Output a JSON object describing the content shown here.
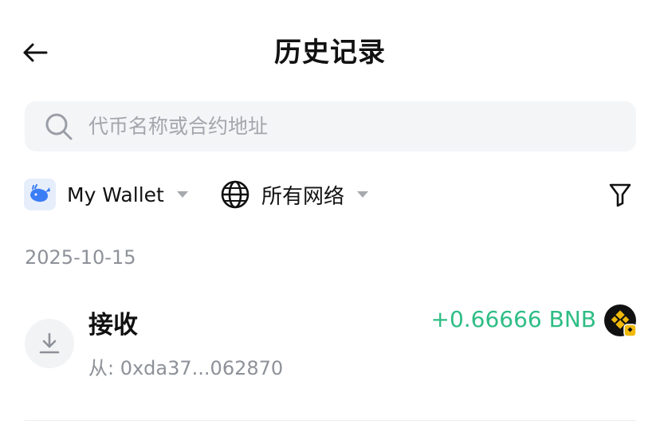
{
  "header": {
    "title": "历史记录"
  },
  "search": {
    "placeholder": "代币名称或合约地址"
  },
  "filters": {
    "wallet_name": "My Wallet",
    "network_name": "所有网络"
  },
  "date_group": "2025-10-15",
  "transactions": [
    {
      "type": "接收",
      "from": "从: 0xda37...062870",
      "amount": "+0.66666 BNB",
      "amount_color": "#2ebd85"
    }
  ],
  "icons": {
    "back": "arrow-left-icon",
    "search": "search-icon",
    "wallet": "whale-logo-icon",
    "network": "globe-icon",
    "filter": "funnel-icon",
    "receive": "download-icon",
    "token": "bnb-logo-icon"
  }
}
